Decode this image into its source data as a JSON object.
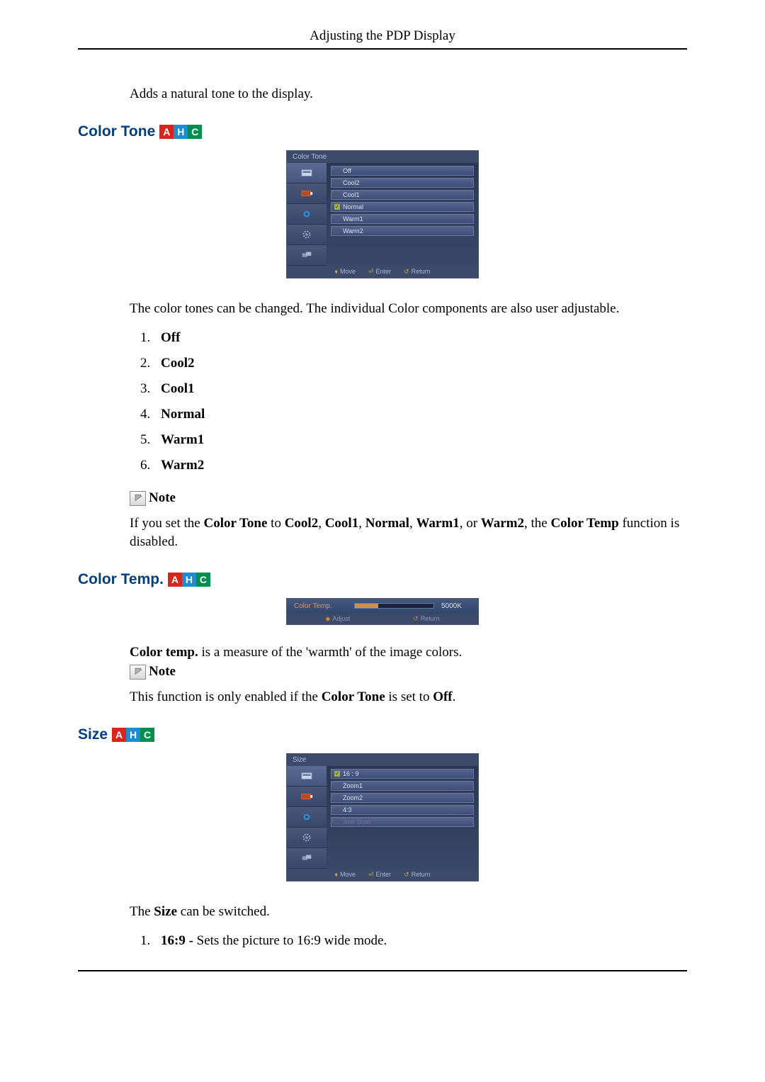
{
  "header": {
    "title": "Adjusting the PDP Display"
  },
  "intro_text": "Adds a natural tone to the display.",
  "sections": {
    "color_tone": {
      "heading": "Color Tone",
      "badges": [
        "A",
        "H",
        "C"
      ],
      "osd": {
        "title": "Color Tone",
        "options": [
          "Off",
          "Cool2",
          "Cool1",
          "Normal",
          "Warm1",
          "Warm2"
        ],
        "selected": "Normal",
        "footer": {
          "move": "Move",
          "enter": "Enter",
          "return": "Return"
        }
      },
      "description": "The color tones can be changed. The individual Color components are also user adjustable.",
      "list_items": [
        "Off",
        "Cool2",
        "Cool1",
        "Normal",
        "Warm1",
        "Warm2"
      ],
      "note_label": "Note",
      "note_text_parts": [
        "If you set the ",
        "Color Tone",
        " to ",
        "Cool2",
        ", ",
        "Cool1",
        ", ",
        "Normal",
        ", ",
        "Warm1",
        ", or ",
        "Warm2",
        ", the ",
        "Color Temp",
        " function is disabled."
      ]
    },
    "color_temp": {
      "heading": "Color Temp.",
      "badges": [
        "A",
        "H",
        "C"
      ],
      "osd": {
        "label": "Color Temp.",
        "value": "5000K",
        "footer": {
          "adjust": "Adjust",
          "return": "Return"
        }
      },
      "desc_parts": [
        "Color temp.",
        " is a measure of the 'warmth' of the image colors."
      ],
      "note_label": "Note",
      "note_text_parts": [
        "This function is only enabled if the ",
        "Color Tone",
        " is set to ",
        "Off",
        "."
      ]
    },
    "size": {
      "heading": "Size",
      "badges": [
        "A",
        "H",
        "C"
      ],
      "osd": {
        "title": "Size",
        "options": [
          "16 : 9",
          "Zoom1",
          "Zoom2",
          "4:3",
          "Just Scan"
        ],
        "selected": "16 : 9",
        "disabled": [
          "Just Scan"
        ],
        "footer": {
          "move": "Move",
          "enter": "Enter",
          "return": "Return"
        }
      },
      "description_parts": [
        "The ",
        "Size",
        " can be switched."
      ],
      "list_items": [
        {
          "bold": "16:9 -",
          "rest": " Sets the picture to 16:9 wide mode."
        }
      ]
    }
  }
}
